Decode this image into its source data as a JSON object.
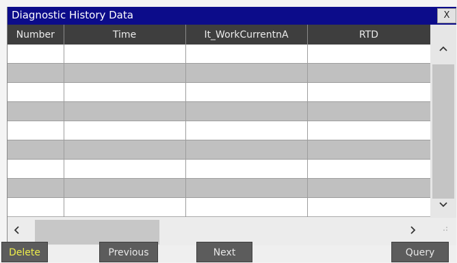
{
  "window": {
    "title": "Diagnostic History Data",
    "close_label": "X"
  },
  "table": {
    "columns": [
      "Number",
      "Time",
      "It_WorkCurrentnA",
      "RTD"
    ],
    "rows": [
      [
        "",
        "",
        "",
        ""
      ],
      [
        "",
        "",
        "",
        ""
      ],
      [
        "",
        "",
        "",
        ""
      ],
      [
        "",
        "",
        "",
        ""
      ],
      [
        "",
        "",
        "",
        ""
      ],
      [
        "",
        "",
        "",
        ""
      ],
      [
        "",
        "",
        "",
        ""
      ],
      [
        "",
        "",
        "",
        ""
      ],
      [
        "",
        "",
        "",
        ""
      ]
    ]
  },
  "scrollbars": {
    "up_icon": "^",
    "down_icon": "v",
    "left_icon": "<",
    "right_icon": ">"
  },
  "buttons": {
    "delete_label": "Delete",
    "previous_label": "Previous",
    "next_label": "Next",
    "query_label": "Query"
  },
  "colors": {
    "title_bar": "#0c0c8a",
    "header_bg": "#3e3e3e",
    "row_even": "#ffffff",
    "row_odd": "#c0c0c0",
    "button_bg": "#5c5c5c",
    "delete_text": "#f0ef4a"
  }
}
